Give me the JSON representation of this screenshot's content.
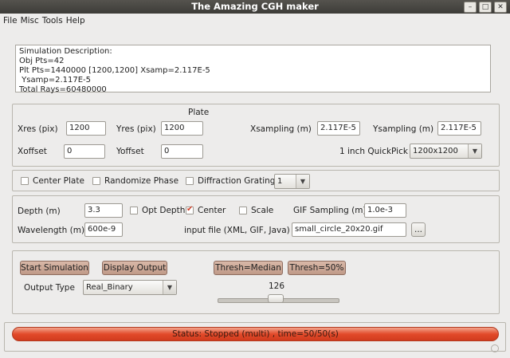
{
  "window": {
    "title": "The Amazing CGH maker",
    "controls": [
      "–",
      "□",
      "✕"
    ]
  },
  "menu": [
    "File",
    "Misc",
    "Tools",
    "Help"
  ],
  "description": [
    "Simulation Description:",
    "Obj Pts=42",
    "Plt Pts=1440000 [1200,1200] Xsamp=2.117E-5",
    " Ysamp=2.117E-5",
    "Total Rays=60480000"
  ],
  "plate": {
    "heading": "Plate",
    "xres_label": "Xres (pix)",
    "xres": "1200",
    "yres_label": "Yres (pix)",
    "yres": "1200",
    "xsamp_label": "Xsampling (m)",
    "xsamp": "2.117E-5",
    "ysamp_label": "Ysampling (m)",
    "ysamp": "2.117E-5",
    "xoff_label": "Xoffset",
    "xoff": "0",
    "yoff_label": "Yoffset",
    "yoff": "0",
    "quickpick_label": "1 inch QuickPick",
    "quickpick": "1200x1200"
  },
  "options": {
    "center_plate": "Center Plate",
    "randomize_phase": "Randomize Phase",
    "diffraction_grating": "Diffraction Grating",
    "grating_value": "1"
  },
  "object": {
    "depth_label": "Depth (m)",
    "depth": "3.3",
    "opt_depth": "Opt Depth",
    "center": "Center",
    "center_checked": true,
    "scale": "Scale",
    "gif_label": "GIF Sampling (m)",
    "gif": "1.0e-3",
    "wavelength_label": "Wavelength (m)",
    "wavelength": "600e-9",
    "input_label": "input file (XML, GIF, Java)",
    "input_file": "small_circle_20x20.gif",
    "browse": "..."
  },
  "sim": {
    "start": "Start Simulation",
    "display": "Display Output",
    "thresh_median": "Thresh=Median",
    "thresh_50": "Thresh=50%",
    "output_type_label": "Output Type",
    "output_type": "Real_Binary",
    "slider_value": "126"
  },
  "status": {
    "text": "Status:  Stopped (multi) , time=50/50(s)",
    "progress": 1.0
  }
}
